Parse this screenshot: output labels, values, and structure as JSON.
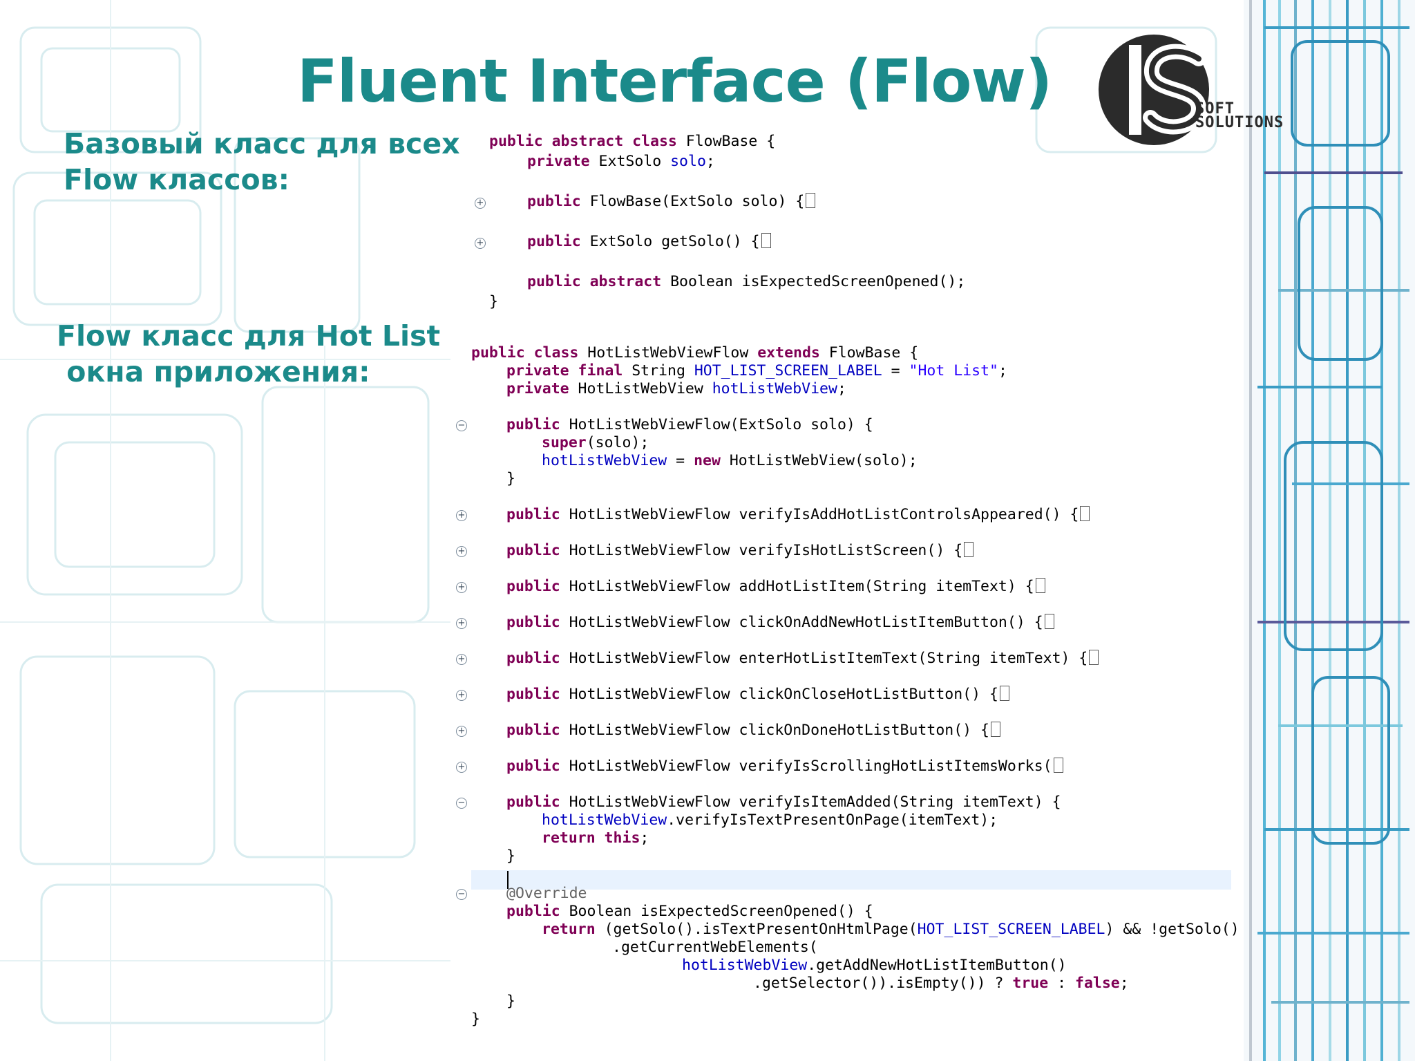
{
  "title": "Fluent Interface (Flow)",
  "logo": {
    "text_top": "SOFT",
    "text_bottom": "SOLUTIONS"
  },
  "captions": {
    "base": [
      "Базовый класс для всех",
      "Flow классов:"
    ],
    "hotlist": [
      "Flow класс для Hot List",
      " окна приложения:"
    ]
  },
  "colors": {
    "title": "#1b8a8a",
    "keyword": "#7f0055",
    "field": "#0000c0",
    "string": "#2a00ff"
  },
  "icons": {
    "expand": "plus-circle-icon",
    "collapse": "minus-circle-icon",
    "folded": "collapsed-block-icon"
  }
}
